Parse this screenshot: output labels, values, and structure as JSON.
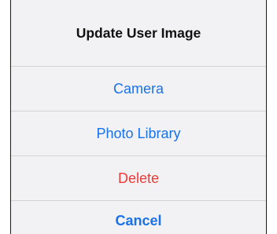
{
  "sheet": {
    "title": "Update User Image",
    "actions": [
      {
        "label": "Camera",
        "style": "default"
      },
      {
        "label": "Photo Library",
        "style": "default"
      },
      {
        "label": "Delete",
        "style": "destructive"
      }
    ],
    "cancel_label": "Cancel"
  },
  "colors": {
    "action_blue": "#1a72e8",
    "destructive_red": "#ea3b38",
    "sheet_background": "#f2f2f4",
    "separator": "#d3d3d6"
  }
}
